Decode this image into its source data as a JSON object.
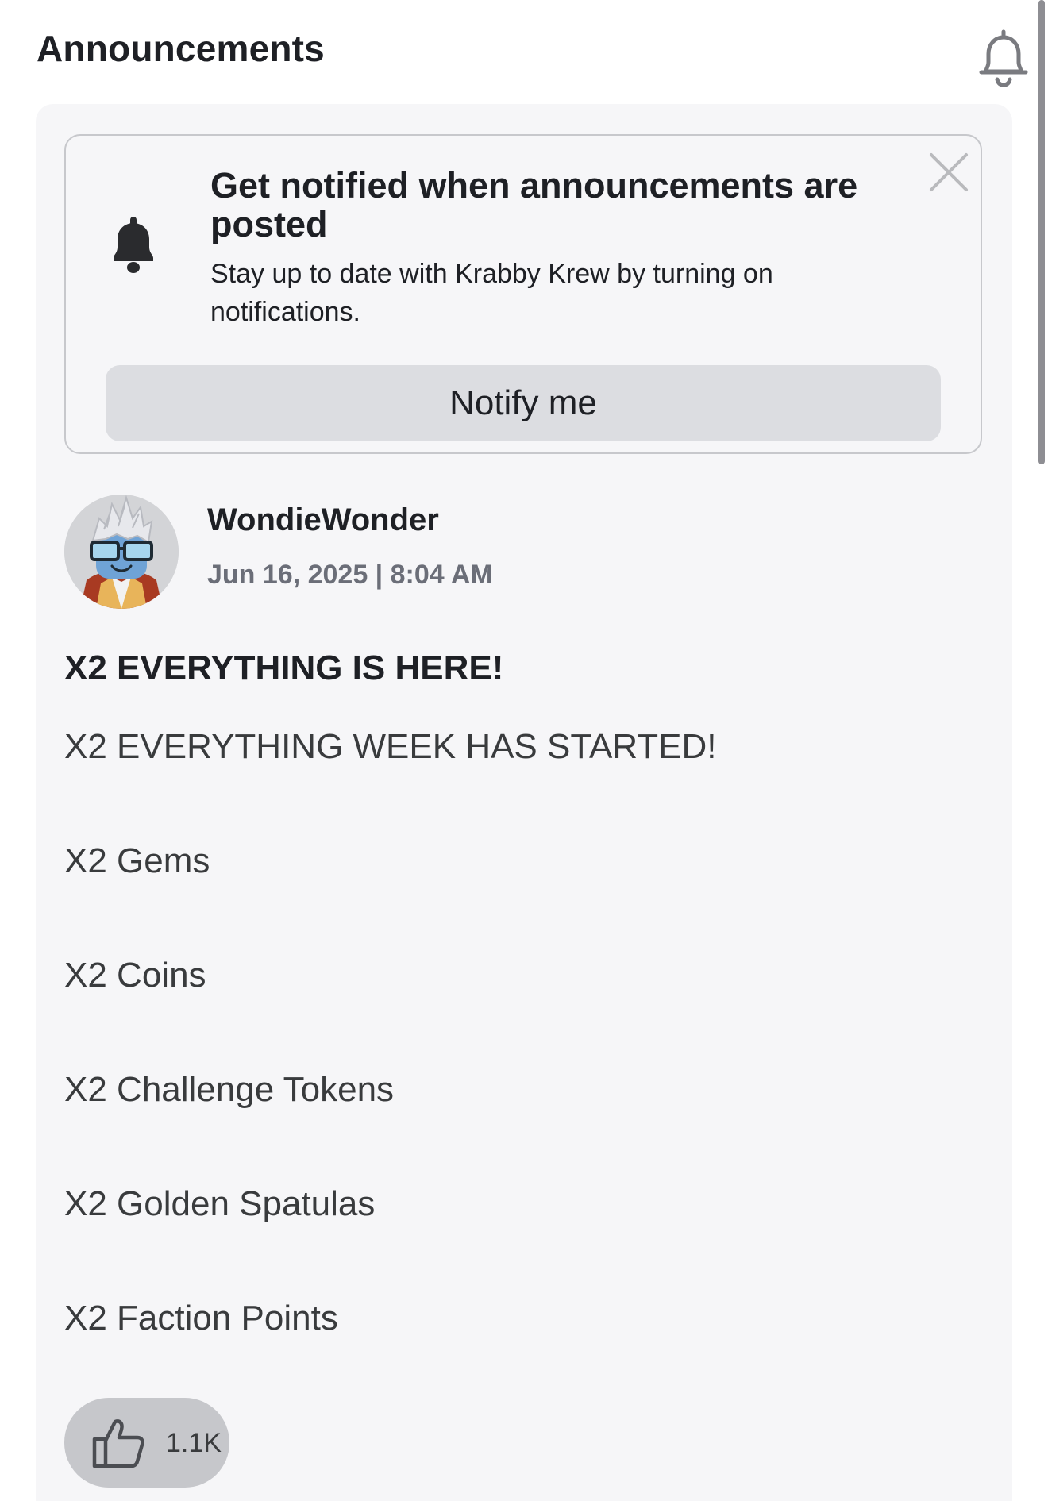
{
  "header": {
    "title": "Announcements",
    "bell_icon": "bell-outline-icon"
  },
  "notify_card": {
    "icon": "bell-filled-icon",
    "close_icon": "close-icon",
    "heading": "Get notified when announcements are posted",
    "description": "Stay up to date with Krabby Krew by turning on notifications.",
    "button_label": "Notify me"
  },
  "post": {
    "author": "WondieWonder",
    "date": "Jun 16, 2025 | 8:04 AM",
    "title": "X2 EVERYTHING IS HERE!",
    "body": [
      "X2 EVERYTHING WEEK HAS STARTED!",
      "X2 Gems",
      "X2 Coins",
      "X2 Challenge Tokens",
      "X2 Golden Spatulas",
      "X2 Faction Points"
    ],
    "like_icon": "thumbs-up-icon",
    "like_count": "1.1K"
  },
  "colors": {
    "panel_background": "#f6f6f8",
    "button_background": "#dcdde1",
    "like_background": "#c6c7cb",
    "muted_text": "#6b6e78"
  }
}
